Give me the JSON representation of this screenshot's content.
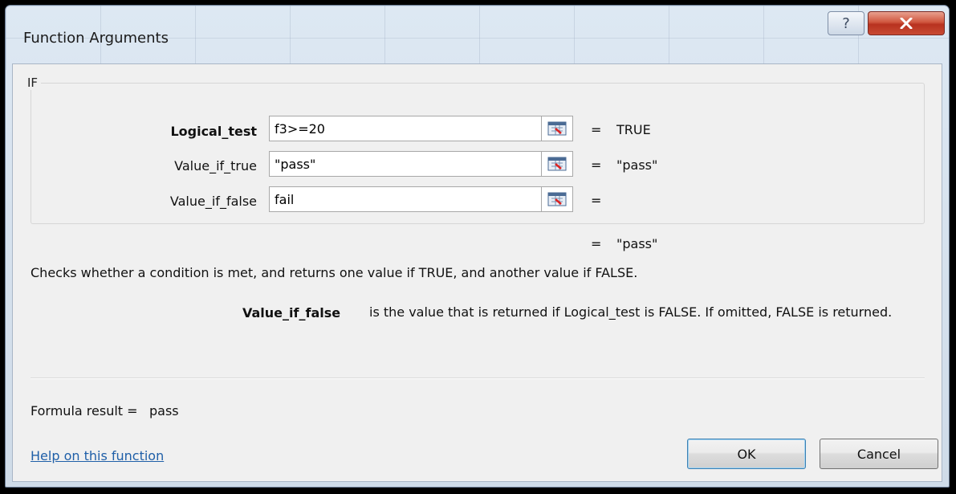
{
  "window": {
    "title": "Function Arguments"
  },
  "titlebar": {
    "help_glyph": "?",
    "close_icon": "close-icon"
  },
  "function_group": {
    "label": "IF"
  },
  "args": [
    {
      "label": "Logical_test",
      "value": "f3>=20",
      "equals": "=",
      "result": "TRUE"
    },
    {
      "label": "Value_if_true",
      "value": "\"pass\"",
      "equals": "=",
      "result": "\"pass\""
    },
    {
      "label": "Value_if_false",
      "value": "fail",
      "equals": "=",
      "result": ""
    }
  ],
  "overall": {
    "equals": "=",
    "result": "\"pass\""
  },
  "description": "Checks whether a condition is met, and returns one value if TRUE, and another value if FALSE.",
  "arg_help": {
    "name": "Value_if_false",
    "text": "is the value that is returned if Logical_test is FALSE. If omitted, FALSE is returned."
  },
  "formula_result": {
    "label": "Formula result =",
    "value": "pass"
  },
  "help_link": "Help on this function",
  "buttons": {
    "ok": "OK",
    "cancel": "Cancel"
  },
  "colors": {
    "link": "#1f5fa8",
    "close": "#c84a33"
  }
}
